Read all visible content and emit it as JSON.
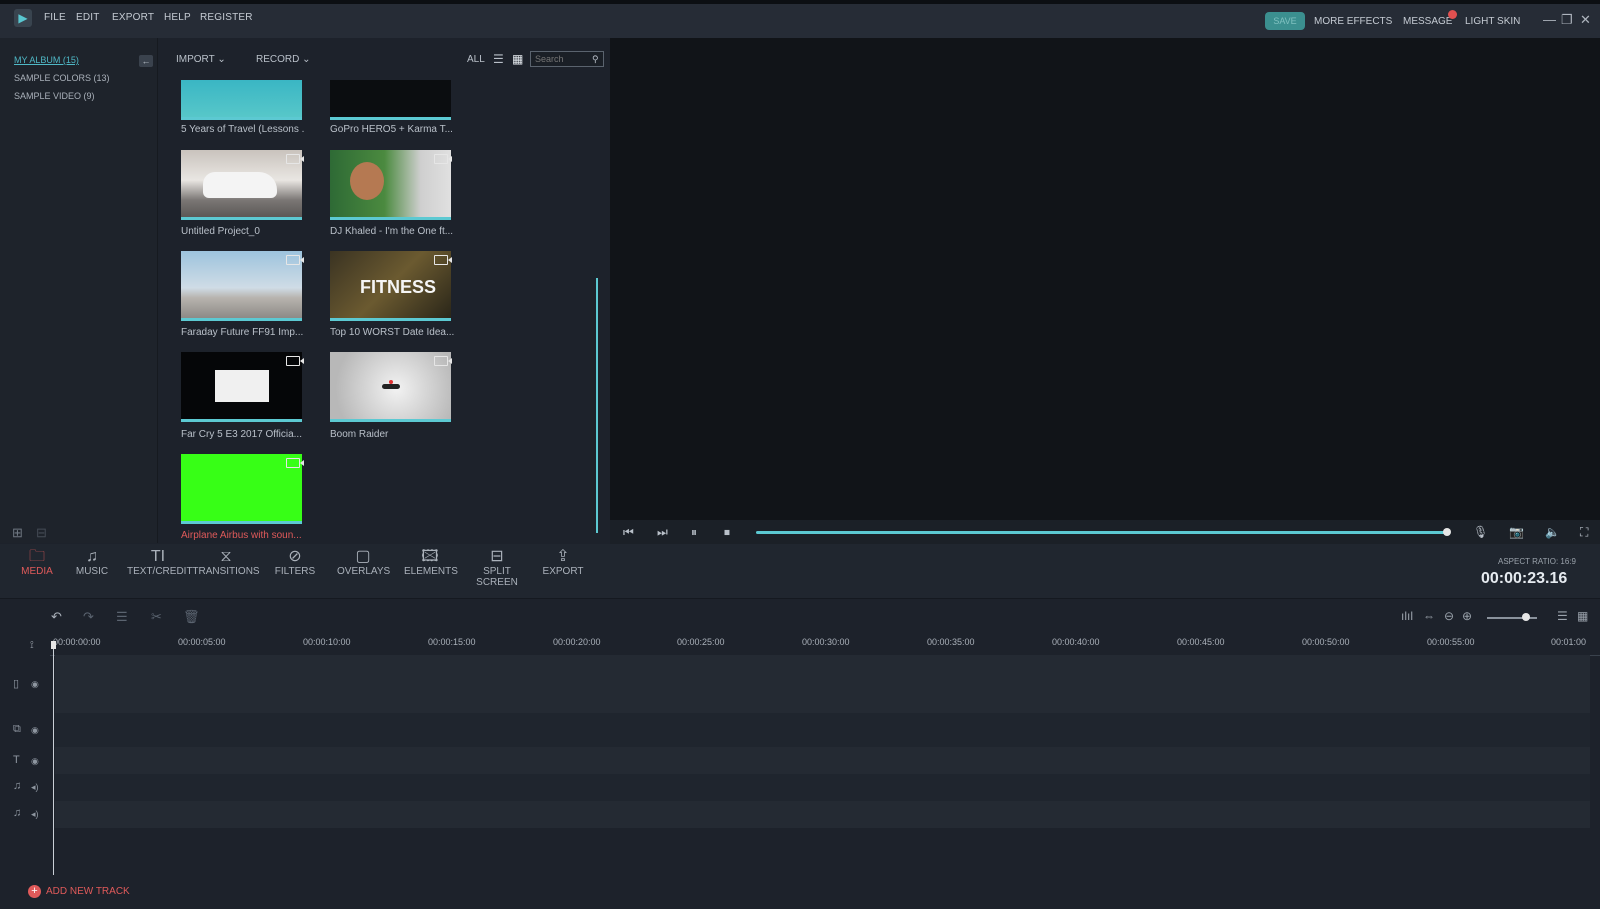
{
  "menu": [
    "FILE",
    "EDIT",
    "EXPORT",
    "HELP",
    "REGISTER"
  ],
  "topright": {
    "save": "SAVE",
    "more_effects": "MORE EFFECTS",
    "message": "MESSAGE",
    "skin": "LIGHT SKIN"
  },
  "albums": [
    "MY ALBUM (15)",
    "SAMPLE COLORS (13)",
    "SAMPLE VIDEO (9)"
  ],
  "toolbar": {
    "import": "IMPORT",
    "record": "RECORD",
    "all": "ALL",
    "search_placeholder": "Search"
  },
  "media": [
    {
      "caption": "5 Years of Travel (Lessons ..."
    },
    {
      "caption": "GoPro HERO5 + Karma T..."
    },
    {
      "caption": "Untitled Project_0"
    },
    {
      "caption": "DJ Khaled - I'm the One ft..."
    },
    {
      "caption": "Faraday Future FF91 Imp..."
    },
    {
      "caption": "Top 10 WORST Date Idea..."
    },
    {
      "caption": "Far Cry 5 E3 2017 Officia..."
    },
    {
      "caption": "Boom Raider"
    },
    {
      "caption": "Airplane Airbus with soun..."
    }
  ],
  "thumb_text": {
    "fitness": "FITNESS"
  },
  "tools": [
    "MEDIA",
    "MUSIC",
    "TEXT/CREDIT",
    "TRANSITIONS",
    "FILTERS",
    "OVERLAYS",
    "ELEMENTS",
    "SPLIT SCREEN",
    "EXPORT"
  ],
  "aspect_ratio": "ASPECT RATIO: 16:9",
  "timecode": "00:00:23.16",
  "ruler": [
    "00:00:00:00",
    "00:00:05:00",
    "00:00:10:00",
    "00:00:15:00",
    "00:00:20:00",
    "00:00:25:00",
    "00:00:30:00",
    "00:00:35:00",
    "00:00:40:00",
    "00:00:45:00",
    "00:00:50:00",
    "00:00:55:00",
    "00:01:00"
  ],
  "add_track": "ADD NEW TRACK",
  "colors": {
    "accent": "#5cc9d2",
    "active": "#e05a5a",
    "bg": "#1d222b"
  }
}
